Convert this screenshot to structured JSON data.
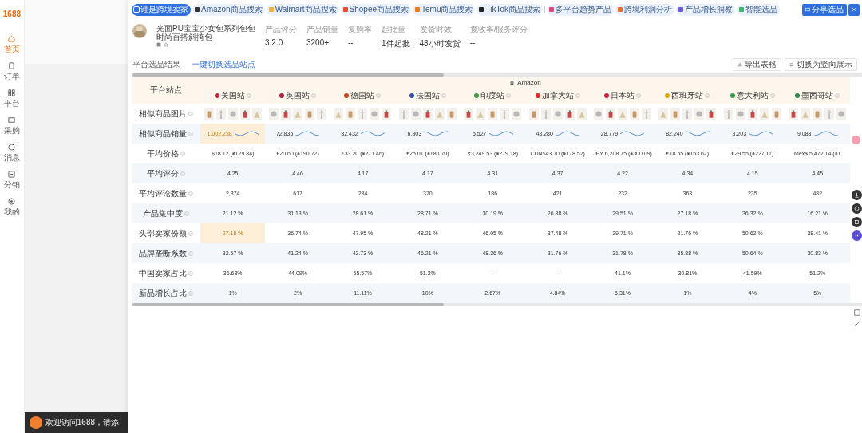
{
  "sidebar": {
    "logo": "1688",
    "items": [
      {
        "label": "首页",
        "selected": true
      },
      {
        "label": "订单",
        "selected": false
      },
      {
        "label": "平台",
        "selected": false
      },
      {
        "label": "采购",
        "selected": false
      },
      {
        "label": "消息",
        "selected": false
      },
      {
        "label": "分销",
        "selected": false
      },
      {
        "label": "我的",
        "selected": false
      }
    ]
  },
  "toolbar": {
    "tabs": [
      {
        "label": "谁是跨境卖家",
        "selected": true,
        "color": "#2f6fde"
      },
      {
        "label": "Amazon商品搜索",
        "selected": false,
        "color": "#333333"
      },
      {
        "label": "Walmart商品搜索",
        "selected": false,
        "color": "#f2b233"
      },
      {
        "label": "Shopee商品搜索",
        "selected": false,
        "color": "#e8492b"
      },
      {
        "label": "Temu商品搜索",
        "selected": false,
        "color": "#f07b1e"
      },
      {
        "label": "TikTok商品搜索",
        "selected": false,
        "color": "#222222"
      },
      {
        "label": "多平台趋势产品",
        "selected": false,
        "color": "#e0457b"
      },
      {
        "label": "跨境利润分析",
        "selected": false,
        "color": "#f06a2a"
      },
      {
        "label": "产品增长洞察",
        "selected": false,
        "color": "#6a5ad6"
      },
      {
        "label": "智能选品",
        "selected": false,
        "color": "#3cb56a"
      }
    ],
    "share_button": "分享选品"
  },
  "product": {
    "title": "光面PU宝宝少女包系列包包时尚百搭斜挎包",
    "stats": [
      {
        "label": "产品评分",
        "value": "3.2.0"
      },
      {
        "label": "产品销量",
        "value": "3200+"
      },
      {
        "label": "复购率",
        "value": "--"
      },
      {
        "label": "起批量",
        "value": "1件起批"
      },
      {
        "label": "发货时效",
        "value": "48小时发货"
      },
      {
        "label": "揽收率/服务评分",
        "value": "--"
      }
    ]
  },
  "results": {
    "title": "平台选品结果",
    "link": "一键切换选品站点",
    "buttons": [
      "导出表格",
      "切换为竖向展示"
    ]
  },
  "table": {
    "corner": "平台站点",
    "platform": "Amazon",
    "columns": [
      {
        "label": "美国站",
        "color": "#c8283c"
      },
      {
        "label": "英国站",
        "color": "#b02040"
      },
      {
        "label": "德国站",
        "color": "#d04010"
      },
      {
        "label": "法国站",
        "color": "#3050a8"
      },
      {
        "label": "印度站",
        "color": "#3a9a40"
      },
      {
        "label": "加拿大站",
        "color": "#e02828"
      },
      {
        "label": "日本站",
        "color": "#d81e3c"
      },
      {
        "label": "西班牙站",
        "color": "#e8a800"
      },
      {
        "label": "意大利站",
        "color": "#2a9a48"
      },
      {
        "label": "墨西哥站",
        "color": "#2a8048"
      }
    ],
    "rows": [
      {
        "label": "相似商品图片",
        "kind": "images"
      },
      {
        "label": "相似商品销量",
        "kind": "sales",
        "cells": [
          {
            "value": "1,002,238",
            "highlight": true
          },
          {
            "value": "72,835",
            "highlight": false
          },
          {
            "value": "32,432",
            "highlight": false
          },
          {
            "value": "6,803",
            "highlight": false
          },
          {
            "value": "5,527",
            "highlight": false
          },
          {
            "value": "43,280",
            "highlight": false
          },
          {
            "value": "28,779",
            "highlight": false
          },
          {
            "value": "82,240",
            "highlight": false
          },
          {
            "value": "8,203",
            "highlight": false
          },
          {
            "value": "9,083",
            "highlight": false
          }
        ]
      },
      {
        "label": "平均价格",
        "kind": "text",
        "cells": [
          {
            "value": "$18.12 (¥129.84)",
            "highlight": false
          },
          {
            "value": "£20.60 (¥190.72)",
            "highlight": false
          },
          {
            "value": "€33.20 (¥271.46)",
            "highlight": false
          },
          {
            "value": "€25.01 (¥180.70)",
            "highlight": false
          },
          {
            "value": "₹3,249.53 (¥279.18)",
            "highlight": false
          },
          {
            "value": "CDN$43.70 (¥178.52)",
            "highlight": false
          },
          {
            "value": "JPY 6,208.75 (¥300.09)",
            "highlight": false
          },
          {
            "value": "€18.55 (¥153.62)",
            "highlight": false
          },
          {
            "value": "€29.55 (¥227.11)",
            "highlight": false
          },
          {
            "value": "Mex$ 5,472.14 (¥1",
            "highlight": false
          }
        ]
      },
      {
        "label": "平均评分",
        "kind": "text",
        "cells": [
          {
            "value": "4.25",
            "highlight": false
          },
          {
            "value": "4.46",
            "highlight": false
          },
          {
            "value": "4.17",
            "highlight": false
          },
          {
            "value": "4.17",
            "highlight": false
          },
          {
            "value": "4.31",
            "highlight": false
          },
          {
            "value": "4.37",
            "highlight": false
          },
          {
            "value": "4.22",
            "highlight": false
          },
          {
            "value": "4.34",
            "highlight": false
          },
          {
            "value": "4.15",
            "highlight": false
          },
          {
            "value": "4.45",
            "highlight": false
          }
        ]
      },
      {
        "label": "平均评论数量",
        "kind": "text",
        "cells": [
          {
            "value": "2,374",
            "highlight": false
          },
          {
            "value": "617",
            "highlight": false
          },
          {
            "value": "234",
            "highlight": false
          },
          {
            "value": "370",
            "highlight": false
          },
          {
            "value": "186",
            "highlight": false
          },
          {
            "value": "421",
            "highlight": false
          },
          {
            "value": "232",
            "highlight": false
          },
          {
            "value": "363",
            "highlight": false
          },
          {
            "value": "235",
            "highlight": false
          },
          {
            "value": "482",
            "highlight": false
          }
        ]
      },
      {
        "label": "产品集中度",
        "kind": "text",
        "cells": [
          {
            "value": "21.12 %",
            "highlight": false
          },
          {
            "value": "31.13 %",
            "highlight": false
          },
          {
            "value": "28.61 %",
            "highlight": false
          },
          {
            "value": "28.71 %",
            "highlight": false
          },
          {
            "value": "30.19 %",
            "highlight": false
          },
          {
            "value": "26.88 %",
            "highlight": false
          },
          {
            "value": "29.51 %",
            "highlight": false
          },
          {
            "value": "27.18 %",
            "highlight": false
          },
          {
            "value": "36.32 %",
            "highlight": false
          },
          {
            "value": "16.21 %",
            "highlight": false
          }
        ]
      },
      {
        "label": "头部卖家份额",
        "kind": "text",
        "cells": [
          {
            "value": "27.18 %",
            "highlight": true
          },
          {
            "value": "36.74 %",
            "highlight": false
          },
          {
            "value": "47.95 %",
            "highlight": false
          },
          {
            "value": "48.21 %",
            "highlight": false
          },
          {
            "value": "46.05 %",
            "highlight": false
          },
          {
            "value": "37.48 %",
            "highlight": false
          },
          {
            "value": "39.71 %",
            "highlight": false
          },
          {
            "value": "21.76 %",
            "highlight": false
          },
          {
            "value": "50.62 %",
            "highlight": false
          },
          {
            "value": "38.41 %",
            "highlight": false
          }
        ]
      },
      {
        "label": "品牌垄断系数",
        "kind": "text",
        "cells": [
          {
            "value": "32.57 %",
            "highlight": false
          },
          {
            "value": "41.24 %",
            "highlight": false
          },
          {
            "value": "42.73 %",
            "highlight": false
          },
          {
            "value": "46.21 %",
            "highlight": false
          },
          {
            "value": "48.36 %",
            "highlight": false
          },
          {
            "value": "31.76 %",
            "highlight": false
          },
          {
            "value": "31.78 %",
            "highlight": false
          },
          {
            "value": "35.88 %",
            "highlight": false
          },
          {
            "value": "50.64 %",
            "highlight": false
          },
          {
            "value": "30.83 %",
            "highlight": false
          }
        ]
      },
      {
        "label": "中国卖家占比",
        "kind": "text",
        "cells": [
          {
            "value": "36.63%",
            "highlight": false
          },
          {
            "value": "44.09%",
            "highlight": false
          },
          {
            "value": "55.57%",
            "highlight": false
          },
          {
            "value": "51.2%",
            "highlight": false
          },
          {
            "value": "--",
            "highlight": false
          },
          {
            "value": "--",
            "highlight": false
          },
          {
            "value": "41.1%",
            "highlight": false
          },
          {
            "value": "30.81%",
            "highlight": false
          },
          {
            "value": "41.59%",
            "highlight": false
          },
          {
            "value": "51.2%",
            "highlight": false
          }
        ]
      },
      {
        "label": "新品增长占比",
        "kind": "text",
        "cells": [
          {
            "value": "1%",
            "highlight": false
          },
          {
            "value": "2%",
            "highlight": false
          },
          {
            "value": "11.11%",
            "highlight": false
          },
          {
            "value": "10%",
            "highlight": false
          },
          {
            "value": "2.67%",
            "highlight": false
          },
          {
            "value": "4.84%",
            "highlight": false
          },
          {
            "value": "5.31%",
            "highlight": false
          },
          {
            "value": "1%",
            "highlight": false
          },
          {
            "value": "4%",
            "highlight": false
          },
          {
            "value": "5%",
            "highlight": false
          }
        ]
      }
    ]
  },
  "footer": {
    "text": "欢迎访问1688，请添"
  }
}
